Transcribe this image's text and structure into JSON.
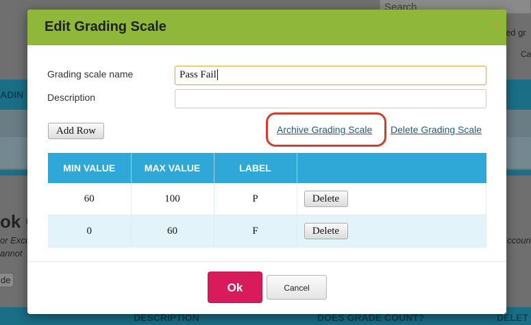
{
  "background": {
    "search_placeholder": "Search",
    "right_fragment_1": "ed gr",
    "right_fragment_2": "Ca",
    "left_band_text": "ADIN",
    "left_heading_fragment": "ok G",
    "left_italic_1": "or Excu",
    "left_italic_2": "annot",
    "right_italic": "ccount",
    "left_chip": "de",
    "bottom_headers": [
      "DESCRIPTION",
      "DOES GRADE COUNT?",
      "DELET"
    ]
  },
  "dialog": {
    "title": "Edit Grading Scale",
    "close_symbol": "×",
    "name_label": "Grading scale name",
    "name_value": "Pass Fail",
    "description_label": "Description",
    "description_value": "",
    "add_row_label": "Add Row",
    "archive_link": "Archive Grading Scale",
    "delete_link": "Delete Grading Scale",
    "table": {
      "headers": [
        "MIN VALUE",
        "MAX VALUE",
        "LABEL",
        ""
      ],
      "rows": [
        {
          "min": "60",
          "max": "100",
          "label": "P",
          "action": "Delete"
        },
        {
          "min": "0",
          "max": "60",
          "label": "F",
          "action": "Delete"
        }
      ]
    },
    "ok_label": "Ok",
    "cancel_label": "Cancel"
  },
  "colors": {
    "header_green": "#8fb73a",
    "table_header_blue": "#2fa8d8",
    "ok_pink": "#d81b5a",
    "highlight_red": "#d23c2a",
    "link_teal": "#1b5c7a"
  }
}
